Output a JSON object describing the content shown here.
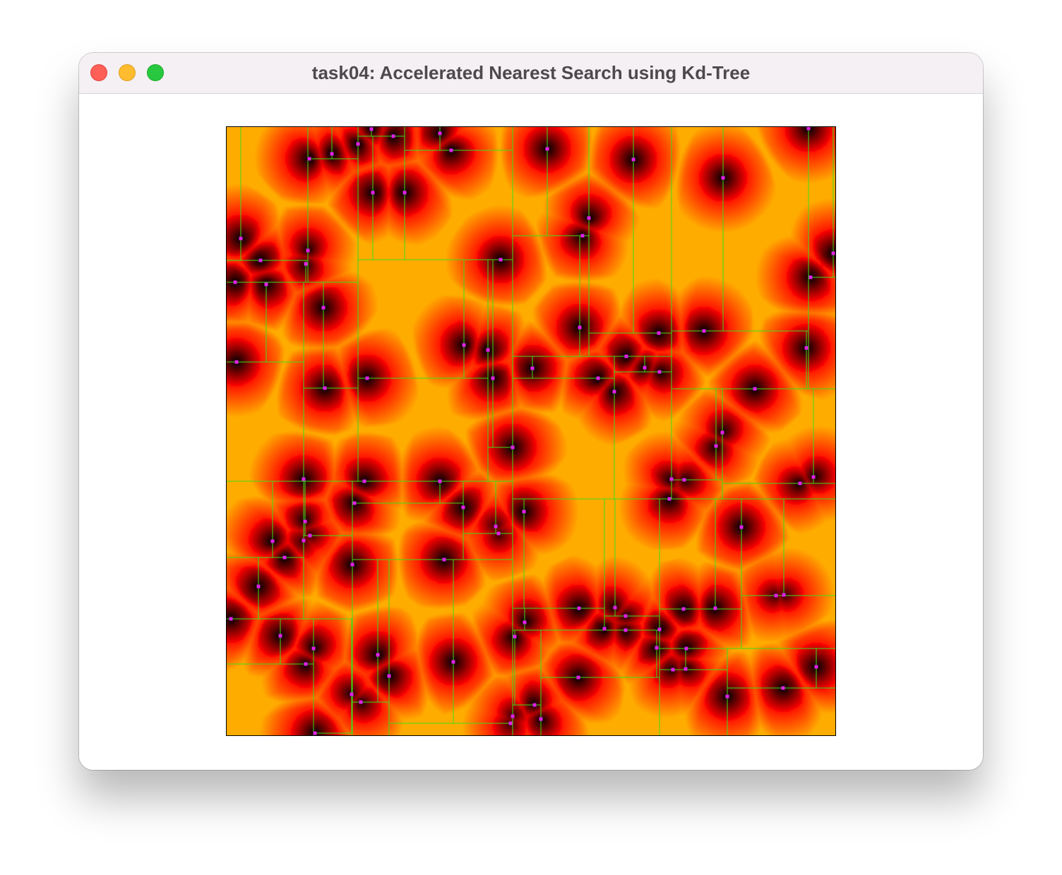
{
  "window": {
    "title": "task04: Accelerated Nearest Search using Kd-Tree"
  },
  "colors": {
    "partition_line": "#3ddc1c",
    "site_marker": "#e020e8",
    "field_dark": "#000000",
    "field_mid": "#ff1500",
    "field_bright": "#ff9a00",
    "canvas_border": "#000000"
  }
}
